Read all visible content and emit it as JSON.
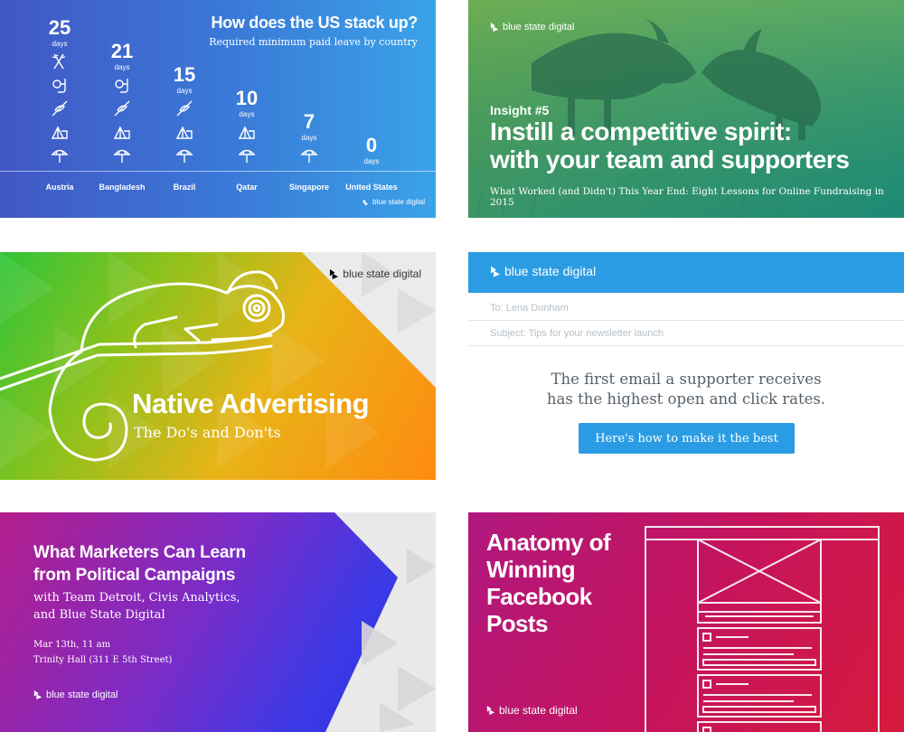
{
  "brand": {
    "name": "blue state digital"
  },
  "tile1": {
    "title": "How does the US stack up?",
    "subtitle": "Required minimum paid leave by country",
    "chart_data": {
      "type": "bar",
      "title": "How does the US stack up?",
      "subtitle": "Required minimum paid leave by country",
      "categories": [
        "Austria",
        "Bangladesh",
        "Brazil",
        "Qatar",
        "Singapore",
        "United States"
      ],
      "values": [
        25,
        21,
        15,
        10,
        7,
        0
      ],
      "unit": "days"
    },
    "icon_names": [
      "ski-icon",
      "snorkel-icon",
      "kayak-icon",
      "camping-icon",
      "beach-umbrella-icon"
    ]
  },
  "tile2": {
    "kicker": "Insight #5",
    "headline_line1": "Instill a competitive spirit:",
    "headline_line2": "with your team and supporters",
    "subtitle": "What Worked (and Didn't) This Year End: Eight Lessons for Online Fundraising in 2015"
  },
  "tile3": {
    "headline": "Native Advertising",
    "subtitle": "The Do's and Don'ts"
  },
  "tile4": {
    "to": "To: Lena Dunham",
    "subject": "Subject: Tips for your newsletter launch",
    "message_line1": "The first email a supporter receives",
    "message_line2": "has the highest open and click rates.",
    "cta": "Here's how to make it the best"
  },
  "tile5": {
    "headline_line1": "What Marketers Can Learn",
    "headline_line2": "from Political Campaigns",
    "sub_line1": "with Team Detroit, Civis Analytics,",
    "sub_line2": "and Blue State Digital",
    "date": "Mar 13th, 11 am",
    "venue": "Trinity Hall (311 E 5th Street)"
  },
  "tile6": {
    "headline_line1": "Anatomy of",
    "headline_line2": "Winning",
    "headline_line3": "Facebook",
    "headline_line4": "Posts"
  },
  "colors": {
    "blue": "#2b9ce4",
    "magenta": "#c4145e",
    "green": "#3e9a6a",
    "orange": "#ff8a10",
    "purple": "#3a3ae6"
  }
}
